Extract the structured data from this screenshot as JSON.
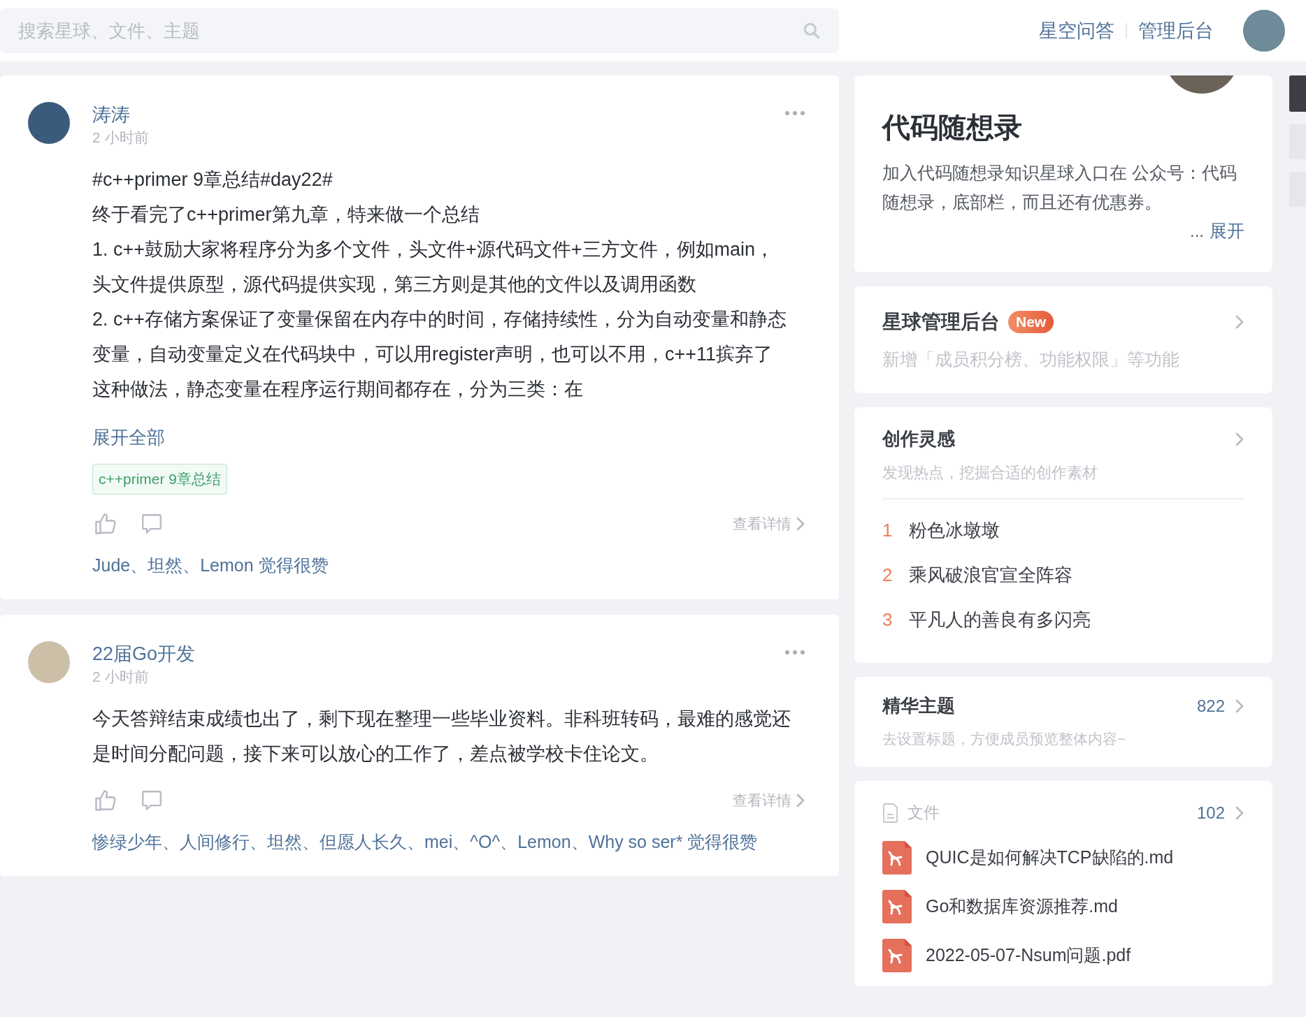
{
  "search": {
    "placeholder": "搜索星球、文件、主题"
  },
  "nav_links": [
    "星空问答",
    "管理后台"
  ],
  "posts": [
    {
      "author": "涛涛",
      "time": "2 小时前",
      "paragraphs": [
        "#c++primer 9章总结#day22#",
        "终于看完了c++primer第九章，特来做一个总结",
        "1. c++鼓励大家将程序分为多个文件，头文件+源代码文件+三方文件，例如main，头文件提供原型，源代码提供实现，第三方则是其他的文件以及调用函数",
        "2. c++存储方案保证了变量保留在内存中的时间，存储持续性，分为自动变量和静态变量，自动变量定义在代码块中，可以用register声明，也可以不用，c++11摈弃了这种做法，静态变量在程序运行期间都存在，分为三类：在"
      ],
      "expand": "展开全部",
      "tags": [
        "c++primer 9章总结"
      ],
      "details": "查看详情",
      "likes": "Jude、坦然、Lemon 觉得很赞"
    },
    {
      "author": "22届Go开发",
      "time": "2 小时前",
      "paragraphs": [
        "今天答辩结束成绩也出了，剩下现在整理一些毕业资料。非科班转码，最难的感觉还是时间分配问题，接下来可以放心的工作了，差点被学校卡住论文。"
      ],
      "details": "查看详情",
      "likes": "惨绿少年、人间修行、坦然、但愿人长久、mei、^O^、Lemon、Why so ser* 觉得很赞"
    }
  ],
  "group_card": {
    "title": "代码随想录",
    "description": "加入代码随想录知识星球入口在 公众号：代码随想录，底部栏，而且还有优惠券。",
    "ellipsis": "...",
    "expand": "展开"
  },
  "admin_card": {
    "title": "星球管理后台",
    "badge": "New",
    "subtitle": "新增「成员积分榜、功能权限」等功能"
  },
  "inspiration": {
    "title": "创作灵感",
    "subtitle": "发现热点，挖掘合适的创作素材",
    "items": [
      {
        "rank": "1",
        "text": "粉色冰墩墩"
      },
      {
        "rank": "2",
        "text": "乘风破浪官宣全阵容"
      },
      {
        "rank": "3",
        "text": "平凡人的善良有多闪亮"
      }
    ]
  },
  "featured": {
    "title": "精华主题",
    "count": "822",
    "subtitle": "去设置标题，方便成员预览整体内容~"
  },
  "side_tabs": [
    {
      "selected": true
    },
    {
      "selected": false
    },
    {
      "selected": false
    }
  ],
  "files": {
    "title": "文件",
    "count": "102",
    "items": [
      "QUIC是如何解决TCP缺陷的.md",
      "Go和数据库资源推荐.md",
      "2022-05-07-Nsum问题.pdf"
    ]
  }
}
